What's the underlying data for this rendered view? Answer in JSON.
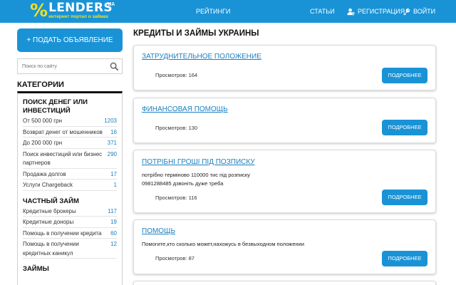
{
  "header": {
    "logo_symbol": "%",
    "logo_text": "LENDERS",
    "logo_tld": "UA",
    "logo_tagline": "интернет портал о займах",
    "nav": {
      "ratings": "РЕЙТИНГИ",
      "articles": "СТАТЬИ",
      "register": "РЕГИСТРАЦИЯ",
      "login": "ВОЙТИ"
    }
  },
  "sidebar": {
    "post_button": "+ ПОДАТЬ ОБЪЯВЛЕНИЕ",
    "search_placeholder": "Поиск по сайту",
    "categories_heading": "КАТЕГОРИИ",
    "groups": [
      {
        "title": "ПОИСК ДЕНЕГ ИЛИ ИНВЕСТИЦИЙ",
        "items": [
          {
            "label": "От 500 000 грн",
            "count": "1203"
          },
          {
            "label": "Возврат денег от мошенников",
            "count": "16"
          },
          {
            "label": "До 200 000 грн",
            "count": "371"
          },
          {
            "label": "Поиск инвестиций или бизнес партнеров",
            "count": "290"
          },
          {
            "label": "Продажа долгов",
            "count": "17"
          },
          {
            "label": "Услуги Chargeback",
            "count": "1"
          }
        ]
      },
      {
        "title": "ЧАСТНЫЙ ЗАЙМ",
        "items": [
          {
            "label": "Кредитные брокеры",
            "count": "117"
          },
          {
            "label": "Кредитные доноры",
            "count": "19"
          },
          {
            "label": "Помощь в получении кредита",
            "count": "60"
          },
          {
            "label": "Помощь в получении кредитных каникул",
            "count": "12"
          }
        ]
      },
      {
        "title": "ЗАЙМЫ",
        "items": []
      }
    ]
  },
  "main": {
    "title": "КРЕДИТЫ И ЗАЙМЫ УКРАИНЫ",
    "more_label": "ПОДРОБНЕЕ",
    "views_label": "Просмотров:",
    "cards": [
      {
        "title": "ЗАТРУДНИТЕЛЬНОЕ ПОЛОЖЕНИЕ",
        "desc": "",
        "views": "164"
      },
      {
        "title": "ФИНАНСОВАЯ ПОМОЩЬ",
        "desc": "",
        "views": "130"
      },
      {
        "title": "ПОТРІБНІ ГРОШІ ПІД ПОЗПИСКУ",
        "desc": "потрібно терміново 110000 тис під розписку\n0981288485 дзвоніть дуже треба",
        "views": "116"
      },
      {
        "title": "ПОМОЩЬ",
        "desc": "Помогите,кто сколько может,нахожусь в безвыходном положении",
        "views": "87"
      }
    ]
  },
  "colors": {
    "brand_blue": "#1a93d6",
    "logo_yellow": "#f3e021",
    "link_blue": "#1a7fc0"
  },
  "icons": {
    "register": "user-key-icon",
    "login": "key-icon",
    "search": "search-icon"
  }
}
